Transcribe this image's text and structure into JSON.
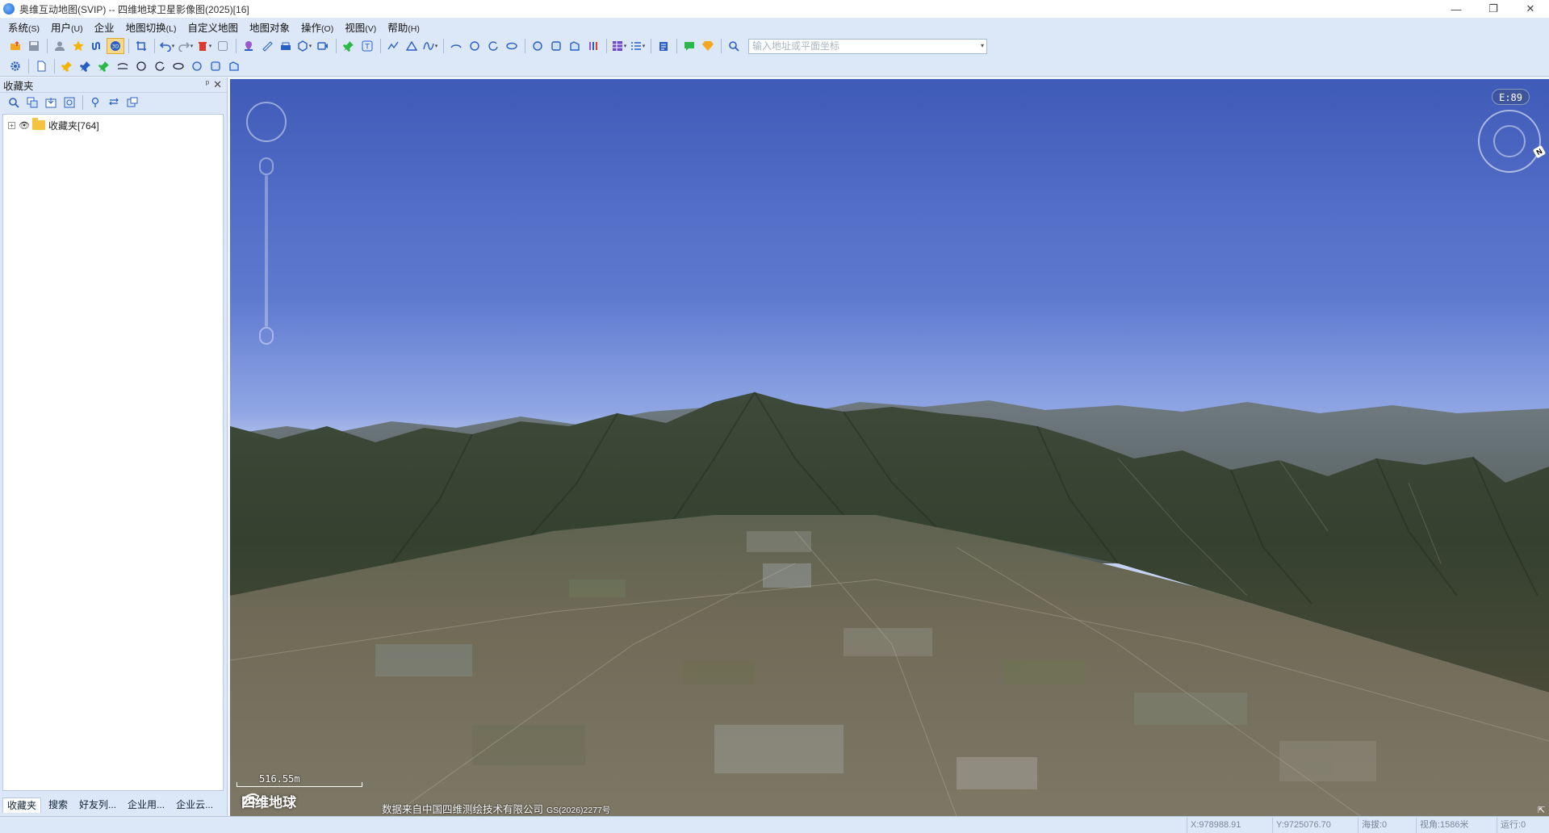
{
  "window": {
    "title": "奥维互动地图(SVIP) -- 四维地球卫星影像图(2025)[16]",
    "controls": [
      "—",
      "❐",
      "✕"
    ]
  },
  "menu": [
    {
      "label": "系统",
      "acc": "(S)"
    },
    {
      "label": "用户",
      "acc": "(U)"
    },
    {
      "label": "企业",
      "acc": ""
    },
    {
      "label": "地图切换",
      "acc": "(L)"
    },
    {
      "label": "自定义地图",
      "acc": ""
    },
    {
      "label": "地图对象",
      "acc": ""
    },
    {
      "label": "操作",
      "acc": "(O)"
    },
    {
      "label": "视图",
      "acc": "(V)"
    },
    {
      "label": "帮助",
      "acc": "(H)"
    }
  ],
  "search": {
    "placeholder": "输入地址或平面坐标"
  },
  "left_panel": {
    "title": "收藏夹",
    "pin": "ᵖ",
    "close": "✕",
    "tree": [
      {
        "label": "收藏夹[764]",
        "expander": "+"
      }
    ],
    "tabs": [
      "收藏夹",
      "搜索",
      "好友列...",
      "企业用...",
      "企业云..."
    ]
  },
  "map": {
    "compass_label": "E:89",
    "compass_n": "N",
    "scale_label": "516.55m",
    "brand": "四维地球",
    "credit": "数据来自中国四维测绘技术有限公司",
    "credit_gs": "GS(2026)2277号",
    "corner": "⇱"
  },
  "status": {
    "x": "X:978988.91",
    "y": "Y:9725076.70",
    "altitude": "海拔:0",
    "view_angle": "视角:1586米",
    "run": "运行:0"
  },
  "colors": {
    "chrome": "#dce8f7",
    "border": "#b8c8de",
    "active_tool": "#f8d88a",
    "sky_top": "#3f5bb8",
    "sky_horizon": "#c5d3f2"
  }
}
